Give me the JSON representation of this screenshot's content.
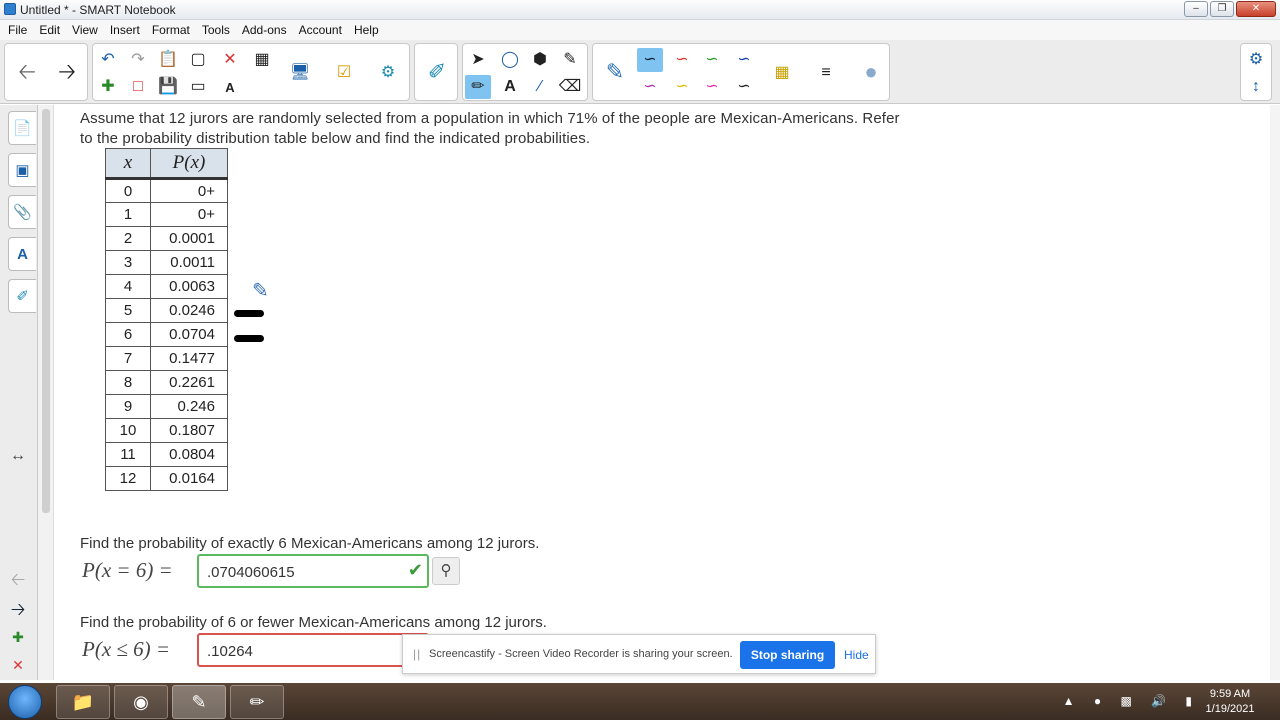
{
  "window": {
    "title": "Untitled * - SMART Notebook"
  },
  "menu": [
    "File",
    "Edit",
    "View",
    "Insert",
    "Format",
    "Tools",
    "Add-ons",
    "Account",
    "Help"
  ],
  "problem": {
    "prompt": "Assume that 12 jurors are randomly selected from a population in which 71% of the people are Mexican-Americans. Refer to the probability distribution table below and find the indicated probabilities.",
    "table_headers": {
      "x": "x",
      "px": "P(x)"
    },
    "rows": [
      {
        "x": "0",
        "p": "0+"
      },
      {
        "x": "1",
        "p": "0+"
      },
      {
        "x": "2",
        "p": "0.0001"
      },
      {
        "x": "3",
        "p": "0.0011"
      },
      {
        "x": "4",
        "p": "0.0063"
      },
      {
        "x": "5",
        "p": "0.0246"
      },
      {
        "x": "6",
        "p": "0.0704"
      },
      {
        "x": "7",
        "p": "0.1477"
      },
      {
        "x": "8",
        "p": "0.2261"
      },
      {
        "x": "9",
        "p": "0.246"
      },
      {
        "x": "10",
        "p": "0.1807"
      },
      {
        "x": "11",
        "p": "0.0804"
      },
      {
        "x": "12",
        "p": "0.0164"
      }
    ],
    "q1": {
      "text": "Find the probability of exactly 6 Mexican-Americans among 12 jurors.",
      "label": "P(x = 6) =",
      "value": ".0704060615"
    },
    "q2": {
      "text": "Find the probability of 6 or fewer Mexican-Americans among 12 jurors.",
      "label": "P(x ≤ 6) =",
      "value": ".10264"
    }
  },
  "screencast": {
    "grip": "||",
    "message": "Screencastify - Screen Video Recorder is sharing your screen.",
    "stop": "Stop sharing",
    "hide": "Hide"
  },
  "taskbar": {
    "time": "9:59 AM",
    "date": "1/19/2021"
  }
}
